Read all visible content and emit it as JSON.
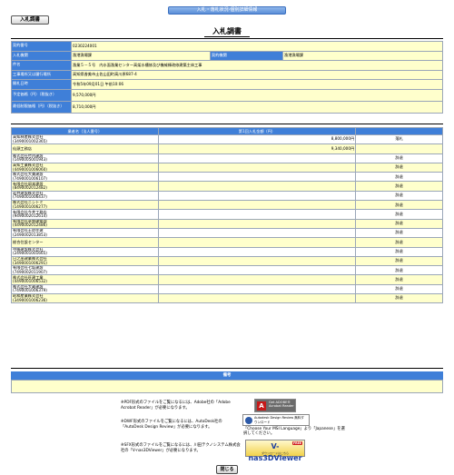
{
  "header": {
    "banner": "入札・落札状況-個別詳細情報",
    "tab_label": "入札調書",
    "page_title": "入札調書"
  },
  "info": {
    "rows": [
      {
        "label": "契約番号",
        "value": "0230224001"
      },
      {
        "label": "入札機関",
        "value": "漁港漁場課",
        "label2": "契約機関",
        "value2": "漁港漁場課"
      },
      {
        "label": "件名",
        "value": "漁業５－５号　内水面漁業センター高架水槽修及び機械棟改修建築主体工事"
      },
      {
        "label": "工事場所又は履行場所",
        "value": "高知県香美市土佐山田町高川原687-4"
      },
      {
        "label": "開札日時",
        "value": "令和5年09月01日 午前10:06"
      },
      {
        "label": "予定価格（円）（税抜き）",
        "value": "9,570,000円"
      },
      {
        "label": "最低制限価格（円）（税抜き）",
        "value": "8,710,000円"
      }
    ]
  },
  "bids": {
    "headers": {
      "name": "業者名（法人番号）",
      "amount": "第1回入札金額（円）",
      "result": ""
    },
    "rows": [
      {
        "name": "高知林産株式会社\n(3490001002365)",
        "amount": "8,800,000円",
        "result": "落札"
      },
      {
        "name": "仙頭工務店",
        "amount": "9,340,000円",
        "result": ""
      },
      {
        "name": "株式会社竹内建設\n(1490005001943)",
        "amount": "",
        "result": "辞退"
      },
      {
        "name": "高知工業株式会社\n(4490001006060)",
        "amount": "",
        "result": "辞退"
      },
      {
        "name": "株式会社大美建設\n(7490001006107)",
        "amount": "",
        "result": "辞退"
      },
      {
        "name": "有限会社岡本建設\n(8490002012482)",
        "amount": "",
        "result": "辞退"
      },
      {
        "name": "岩井建設株式会社\n(7490001006437)",
        "amount": "",
        "result": "辞退"
      },
      {
        "name": "株式会社ニシトミ\n(1490001006277)",
        "amount": "",
        "result": "辞退"
      },
      {
        "name": "有限会社今井工務店\n(9490002012614)",
        "amount": "",
        "result": "辞退"
      },
      {
        "name": "有限会社草野建築部\n(4490002012486)",
        "amount": "",
        "result": "辞退"
      },
      {
        "name": "有限会社土佐住建\n(2490002013853)",
        "amount": "",
        "result": "辞退"
      },
      {
        "name": "総合住設センター",
        "amount": "",
        "result": "辞退"
      },
      {
        "name": "中勝建設株式会社\n(2490001001665)",
        "amount": "",
        "result": "辞退"
      },
      {
        "name": "日之出建業株式会社\n(3490001006291)",
        "amount": "",
        "result": "辞退"
      },
      {
        "name": "有限会社七坂建設\n(7490002011907)",
        "amount": "",
        "result": "辞退"
      },
      {
        "name": "株式会社旺建工業\n(4490001006532)",
        "amount": "",
        "result": "辞退"
      },
      {
        "name": "株式会社大蔵建設\n(7490001006379)",
        "amount": "",
        "result": "辞退"
      },
      {
        "name": "昭和産業株式会社\n(3490001006236)",
        "amount": "",
        "result": "辞退"
      }
    ]
  },
  "remarks": {
    "heading": "備考",
    "body": ""
  },
  "downloads": {
    "pdf_note": "※PDF形式のファイルをご覧になるには、Adobe社の「Adobe Acrobat Reader」が必要になります。",
    "dwf_note": "※DWF形式のファイルをご覧になるには、AutoDesk社の「AutoDesk Design Review」が必要になります。",
    "dwf_extra": "「Choose Your MSI Language」より「Japanese」を選択してください。",
    "sfx_note": "※SFX形式のファイルをご覧になるには、川田テクノシステム株式会社の「V-nas3DViewer」が必要になります。",
    "adobe_logo_text": "Get ADOBE® Acrobat Reader",
    "autodesk_logo_text": "Autodesk Design Review 無料ダウンロード",
    "vnas_logo_text": "V-nas3DViewer",
    "vnas_free_badge": "FREE",
    "vnas_sub": "ダウンロードはこちら"
  },
  "footer": {
    "close_label": "閉じる"
  }
}
